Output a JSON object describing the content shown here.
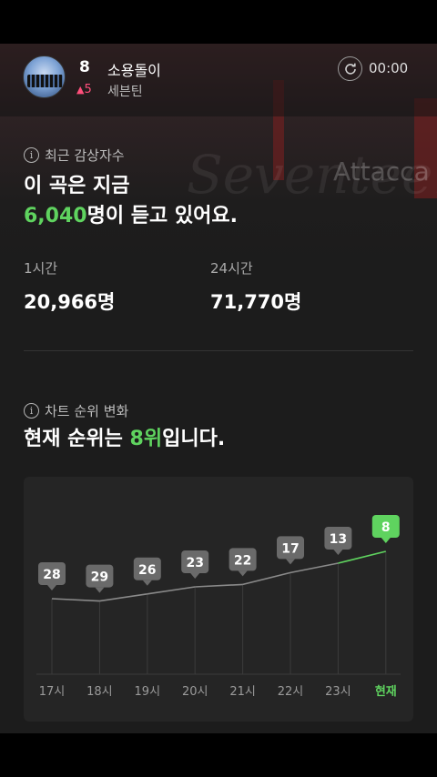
{
  "header": {
    "rank": "8",
    "rank_change": "5",
    "song_title": "소용돌이",
    "artist": "세븐틴",
    "time": "00:00",
    "refresh_icon": "refresh-icon"
  },
  "background": {
    "deco_text_1": "Seventeen",
    "deco_text_2": "Attacca"
  },
  "listeners": {
    "section_label": "최근 감상자수",
    "headline_line1": "이 곡은 지금",
    "current_count": "6,040",
    "headline_suffix": "명이 듣고 있어요.",
    "hour_label": "1시간",
    "hour_value": "20,966명",
    "day_label": "24시간",
    "day_value": "71,770명"
  },
  "rank_chart": {
    "section_label": "차트 순위 변화",
    "headline_prefix": "현재 순위는 ",
    "current_rank": "8위",
    "headline_suffix": "입니다."
  },
  "colors": {
    "accent_green": "#5fd35f",
    "rank_up_pink": "#ff4f7b",
    "panel_bg": "#1c1c1c"
  },
  "chart_data": {
    "type": "line",
    "categories": [
      "17시",
      "18시",
      "19시",
      "20시",
      "21시",
      "22시",
      "23시",
      "현재"
    ],
    "values": [
      28,
      29,
      26,
      23,
      22,
      17,
      13,
      8
    ],
    "ylim": [
      40,
      0
    ],
    "highlight_last": true
  }
}
